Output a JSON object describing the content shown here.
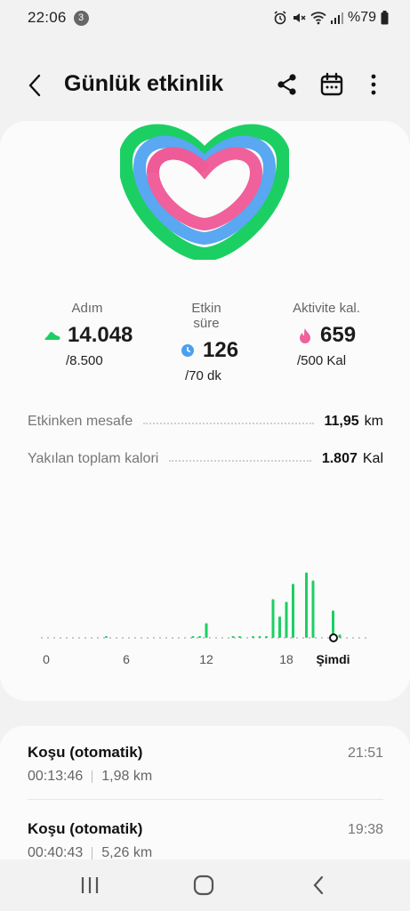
{
  "status_bar": {
    "time": "22:06",
    "notification_count": "3",
    "battery": "%79",
    "icons": [
      "alarm-icon",
      "mute-icon",
      "wifi-icon",
      "signal-icon",
      "battery-icon"
    ]
  },
  "header": {
    "title": "Günlük etkinlik",
    "icons": [
      "back-arrow-icon",
      "share-icon",
      "calendar-icon",
      "more-icon"
    ]
  },
  "ring": {
    "colors": {
      "steps": "#1ccf63",
      "active_time": "#5aa7f2",
      "calories": "#f0609a"
    }
  },
  "stats": [
    {
      "label": "Adım",
      "value": "14.048",
      "goal": "/8.500",
      "icon": "shoe-icon",
      "color": "#1ccf63"
    },
    {
      "label": "Etkin süre",
      "value": "126",
      "goal": "/70 dk",
      "icon": "clock-icon",
      "color": "#4a9ff0"
    },
    {
      "label": "Aktivite kal.",
      "value": "659",
      "goal": "/500 Kal",
      "icon": "flame-icon",
      "color": "#f0609a"
    }
  ],
  "metrics": {
    "distance": {
      "label": "Etkinken mesafe",
      "value": "11,95",
      "unit": "km"
    },
    "calories": {
      "label": "Yakılan toplam kalori",
      "value": "1.807",
      "unit": "Kal"
    }
  },
  "chart_data": {
    "type": "bar",
    "x_ticks": [
      "0",
      "6",
      "12",
      "18",
      "Şimdi"
    ],
    "bar_color": "#1ccf63",
    "ylim": [
      0,
      1
    ],
    "bars": [
      {
        "x": 4.5,
        "value": 0.02
      },
      {
        "x": 11.0,
        "value": 0.02
      },
      {
        "x": 11.5,
        "value": 0.02
      },
      {
        "x": 12.0,
        "value": 0.22
      },
      {
        "x": 14.0,
        "value": 0.02
      },
      {
        "x": 14.5,
        "value": 0.02
      },
      {
        "x": 15.5,
        "value": 0.02
      },
      {
        "x": 16.0,
        "value": 0.02
      },
      {
        "x": 16.5,
        "value": 0.02
      },
      {
        "x": 17.0,
        "value": 0.58
      },
      {
        "x": 17.5,
        "value": 0.32
      },
      {
        "x": 18.0,
        "value": 0.54
      },
      {
        "x": 18.5,
        "value": 0.81
      },
      {
        "x": 19.5,
        "value": 0.98
      },
      {
        "x": 20.0,
        "value": 0.86
      },
      {
        "x": 21.5,
        "value": 0.41
      },
      {
        "x": 22.0,
        "value": 0.05
      }
    ]
  },
  "activities": [
    {
      "name": "Koşu (otomatik)",
      "duration": "00:13:46",
      "distance": "1,98 km",
      "time": "21:51"
    },
    {
      "name": "Koşu (otomatik)",
      "duration": "00:40:43",
      "distance": "5,26 km",
      "time": "19:38"
    }
  ],
  "nav": {
    "icons": [
      "recent-apps-icon",
      "home-icon",
      "back-nav-icon"
    ]
  }
}
